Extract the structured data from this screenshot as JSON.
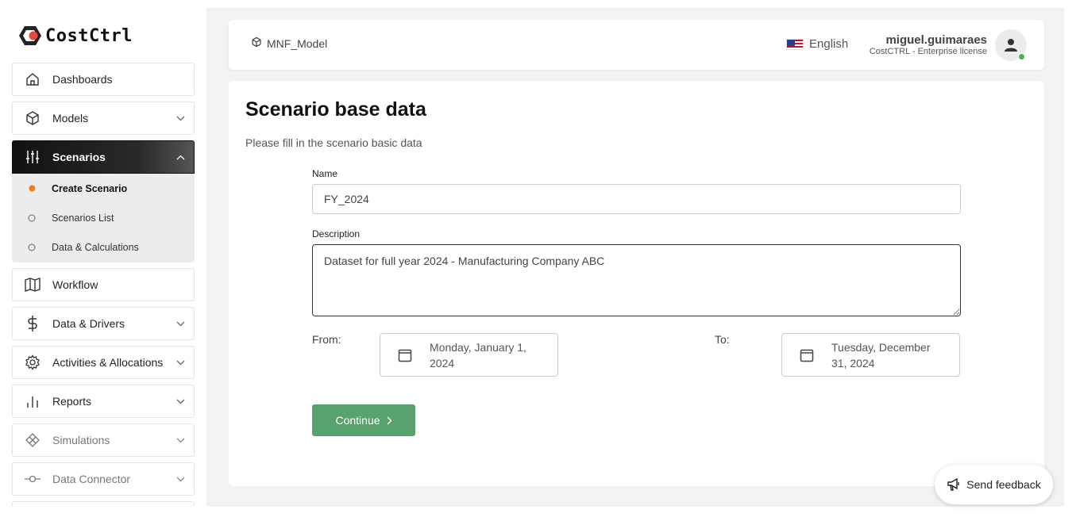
{
  "brand": {
    "name": "CostCtrl",
    "accent": "#e8453c"
  },
  "sidebar": {
    "items": [
      {
        "label": "Dashboards",
        "icon": "home-icon"
      },
      {
        "label": "Models",
        "icon": "cube-icon"
      },
      {
        "label": "Scenarios",
        "icon": "sliders-icon",
        "active": true
      },
      {
        "label": "Workflow",
        "icon": "map-icon"
      },
      {
        "label": "Data & Drivers",
        "icon": "dollar-icon"
      },
      {
        "label": "Activities & Allocations",
        "icon": "gear-icon"
      },
      {
        "label": "Reports",
        "icon": "bar-chart-icon"
      },
      {
        "label": "Simulations",
        "icon": "layers-icon"
      },
      {
        "label": "Data Connector",
        "icon": "connector-icon"
      }
    ],
    "scenario_sub": [
      {
        "label": "Create Scenario",
        "current": true
      },
      {
        "label": "Scenarios List"
      },
      {
        "label": "Data & Calculations"
      }
    ]
  },
  "header": {
    "breadcrumb": "MNF_Model",
    "language": "English",
    "username": "miguel.guimaraes",
    "license": "CostCTRL - Enterprise license"
  },
  "form": {
    "title": "Scenario base data",
    "subtitle": "Please fill in the scenario basic data",
    "name_label": "Name",
    "name_value": "FY_2024",
    "description_label": "Description",
    "description_value": "Dataset for full year 2024 - Manufacturing Company ABC",
    "from_label": "From:",
    "from_line1": "Monday, January 1,",
    "from_line2": "2024",
    "to_label": "To:",
    "to_line1": "Tuesday, December",
    "to_line2": "31, 2024",
    "continue_label": "Continue",
    "continue_color": "#58a36d"
  },
  "feedback": {
    "label": "Send feedback"
  }
}
